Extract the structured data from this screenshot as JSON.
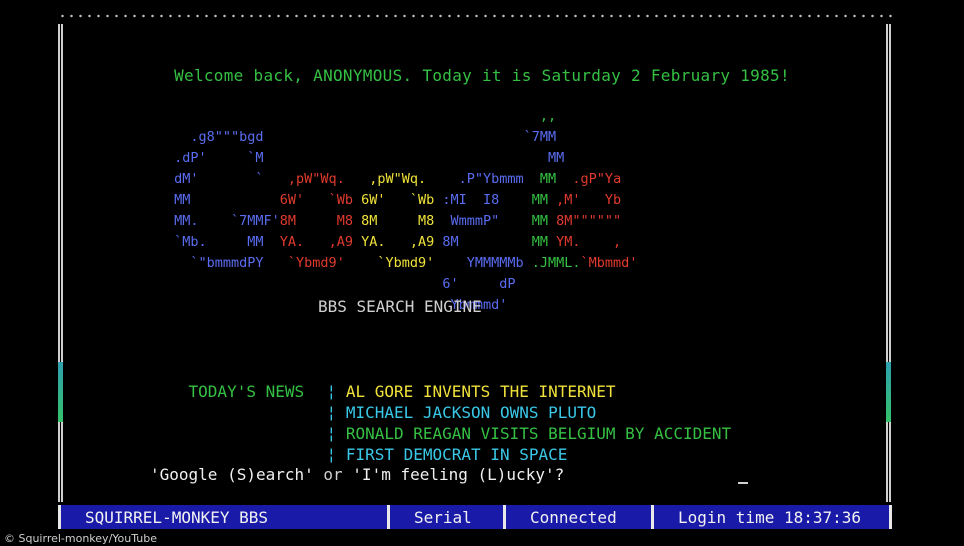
{
  "welcome_text": "Welcome back, ANONYMOUS. Today it is Saturday 2 February 1985!",
  "logo_art": [
    [
      {
        "t": "                                              ,,",
        "c": "gr"
      }
    ],
    [
      {
        "t": "   .g8\"\"\"bgd                                `7MM",
        "c": "gb"
      }
    ],
    [
      {
        "t": " .dP'     `M                                   MM",
        "c": "gb"
      }
    ],
    [
      {
        "t": " dM'       `   ",
        "c": "gb"
      },
      {
        "t": ",pW\"Wq.  ",
        "c": "rd"
      },
      {
        "t": " ,pW\"Wq. ",
        "c": "yl"
      },
      {
        "t": "   .P\"Ybmmm ",
        "c": "gb"
      },
      {
        "t": " MM ",
        "c": "gr"
      },
      {
        "t": " .gP\"Ya",
        "c": "rd"
      }
    ],
    [
      {
        "t": " MM           ",
        "c": "gb"
      },
      {
        "t": "6W'   `Wb ",
        "c": "rd"
      },
      {
        "t": "6W'   `Wb ",
        "c": "yl"
      },
      {
        "t": ":MI  I8  ",
        "c": "gb"
      },
      {
        "t": "  MM ",
        "c": "gr"
      },
      {
        "t": ",M'   Yb",
        "c": "rd"
      }
    ],
    [
      {
        "t": " MM.    `7MMF'",
        "c": "gb"
      },
      {
        "t": "8M     M8 ",
        "c": "rd"
      },
      {
        "t": "8M     M8 ",
        "c": "yl"
      },
      {
        "t": " WmmmP\"  ",
        "c": "gb"
      },
      {
        "t": "  MM ",
        "c": "gr"
      },
      {
        "t": "8M\"\"\"\"\"\"",
        "c": "rd"
      }
    ],
    [
      {
        "t": " `Mb.     MM  ",
        "c": "gb"
      },
      {
        "t": "YA.   ,A9 ",
        "c": "rd"
      },
      {
        "t": "YA.   ,A9 ",
        "c": "yl"
      },
      {
        "t": "8M       ",
        "c": "gb"
      },
      {
        "t": "  MM ",
        "c": "gr"
      },
      {
        "t": "YM.    ,",
        "c": "rd"
      }
    ],
    [
      {
        "t": "   `\"bmmmdPY   ",
        "c": "gb"
      },
      {
        "t": "`Ybmd9'  ",
        "c": "rd"
      },
      {
        "t": "  `Ybmd9'  ",
        "c": "yl"
      },
      {
        "t": "  YMMMMMb ",
        "c": "gb"
      },
      {
        "t": ".JMML.",
        "c": "gr"
      },
      {
        "t": "`Mbmmd'",
        "c": "rd"
      }
    ],
    [
      {
        "t": "                                  6'     dP",
        "c": "gb"
      }
    ],
    [
      {
        "t": "                                   Ybmmmd'",
        "c": "gb"
      }
    ]
  ],
  "engine_label": "BBS SEARCH ENGINE",
  "news": {
    "label": "TODAY'S NEWS",
    "separator": "¦",
    "items": [
      {
        "text": "AL GORE INVENTS THE INTERNET",
        "color": "#f0e23a"
      },
      {
        "text": "MICHAEL JACKSON OWNS PLUTO",
        "color": "#3ac8e8"
      },
      {
        "text": "RONALD REAGAN VISITS BELGIUM BY ACCIDENT",
        "color": "#35c043"
      },
      {
        "text": "FIRST DEMOCRAT IN SPACE",
        "color": "#3ac8e8"
      }
    ]
  },
  "prompt": {
    "option1": "'Google (S)earch'",
    "or_text": " or ",
    "option2": "'I'm feeling (L)ucky'?"
  },
  "status_bar": {
    "bbs_name": "SQUIRREL-MONKEY BBS",
    "port": "Serial",
    "connection": "Connected",
    "login_time": "Login time 18:37:36"
  },
  "caption": "© Squirrel-monkey/YouTube",
  "colors": {
    "background": "#000000",
    "status_bar": "#1a1aa8",
    "green": "#35c043",
    "blue": "#5a6cf0",
    "red": "#e03a2e",
    "yellow": "#f0e23a",
    "cyan": "#3ac8e8"
  }
}
